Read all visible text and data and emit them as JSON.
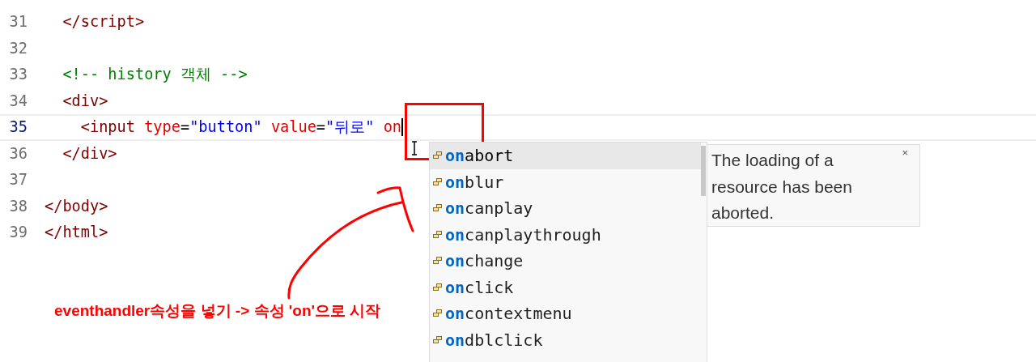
{
  "editor": {
    "lines": [
      {
        "number": "31",
        "current": false,
        "tokens": [
          {
            "kind": "tag",
            "text": "  </script>"
          }
        ]
      },
      {
        "number": "32",
        "current": false
      },
      {
        "number": "33",
        "current": false,
        "tokens": [
          {
            "kind": "comment",
            "text": "  <!-- history 객체 -->"
          }
        ]
      },
      {
        "number": "34",
        "current": false,
        "tokens": [
          {
            "kind": "tag",
            "text": "  <div>"
          }
        ]
      },
      {
        "number": "35",
        "current": true,
        "tokens": [
          {
            "kind": "tag",
            "text": "    <input "
          },
          {
            "kind": "attr",
            "text": "type"
          },
          {
            "kind": "plain",
            "text": "="
          },
          {
            "kind": "string",
            "text": "\"button\" "
          },
          {
            "kind": "attr",
            "text": "value"
          },
          {
            "kind": "plain",
            "text": "="
          },
          {
            "kind": "string",
            "text": "\"뒤로\" "
          },
          {
            "kind": "attr",
            "text": "on"
          }
        ]
      },
      {
        "number": "36",
        "current": false,
        "tokens": [
          {
            "kind": "tag",
            "text": "  </div>"
          }
        ]
      },
      {
        "number": "37",
        "current": false
      },
      {
        "number": "38",
        "current": false,
        "tokens": [
          {
            "kind": "tag",
            "text": "</body>"
          }
        ]
      },
      {
        "number": "39",
        "current": false,
        "tokens": [
          {
            "kind": "tag",
            "text": "</html>"
          }
        ]
      }
    ]
  },
  "suggestions": {
    "items": [
      {
        "match": "on",
        "rest": "abort",
        "selected": true
      },
      {
        "match": "on",
        "rest": "blur",
        "selected": false
      },
      {
        "match": "on",
        "rest": "canplay",
        "selected": false
      },
      {
        "match": "on",
        "rest": "canplaythrough",
        "selected": false
      },
      {
        "match": "on",
        "rest": "change",
        "selected": false
      },
      {
        "match": "on",
        "rest": "click",
        "selected": false
      },
      {
        "match": "on",
        "rest": "contextmenu",
        "selected": false
      },
      {
        "match": "on",
        "rest": "dblclick",
        "selected": false
      }
    ],
    "details": {
      "text": "The loading of a resource has been aborted.",
      "close": "×"
    }
  },
  "annotation": {
    "text": "eventhandler속성을 넣기 -> 속성 'on'으로 시작"
  }
}
